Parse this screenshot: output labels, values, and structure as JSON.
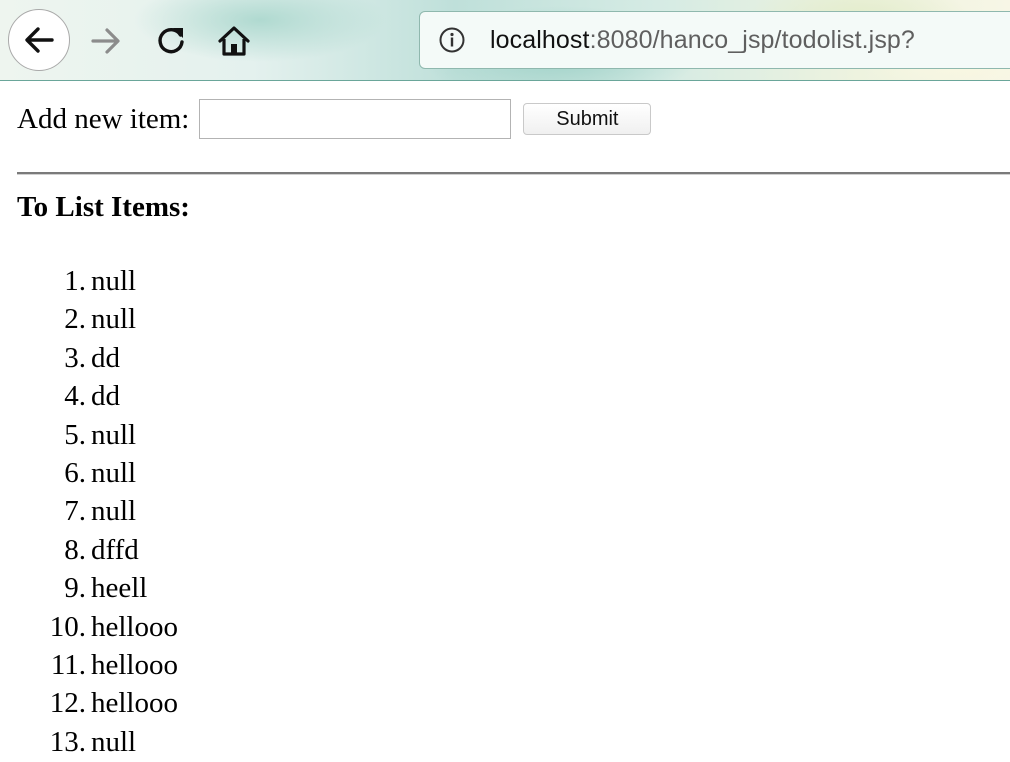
{
  "browser": {
    "url_host": "localhost",
    "url_rest": ":8080/hanco_jsp/todolist.jsp?",
    "icons": {
      "back": "arrow-left-icon",
      "forward": "arrow-right-icon",
      "reload": "reload-icon",
      "home": "home-icon",
      "info": "info-icon"
    }
  },
  "form": {
    "label": "Add new item:",
    "input_value": "",
    "submit_label": "Submit"
  },
  "list": {
    "heading": "To List Items:",
    "items": [
      {
        "number": "1.",
        "text": "null"
      },
      {
        "number": "2.",
        "text": "null"
      },
      {
        "number": "3.",
        "text": "dd"
      },
      {
        "number": "4.",
        "text": "dd"
      },
      {
        "number": "5.",
        "text": "null"
      },
      {
        "number": "6.",
        "text": "null"
      },
      {
        "number": "7.",
        "text": "null"
      },
      {
        "number": "8.",
        "text": "dffd"
      },
      {
        "number": "9.",
        "text": "heell"
      },
      {
        "number": "10.",
        "text": "hellooo"
      },
      {
        "number": "11.",
        "text": "hellooo"
      },
      {
        "number": "12.",
        "text": "hellooo"
      },
      {
        "number": "13.",
        "text": "null"
      }
    ]
  }
}
